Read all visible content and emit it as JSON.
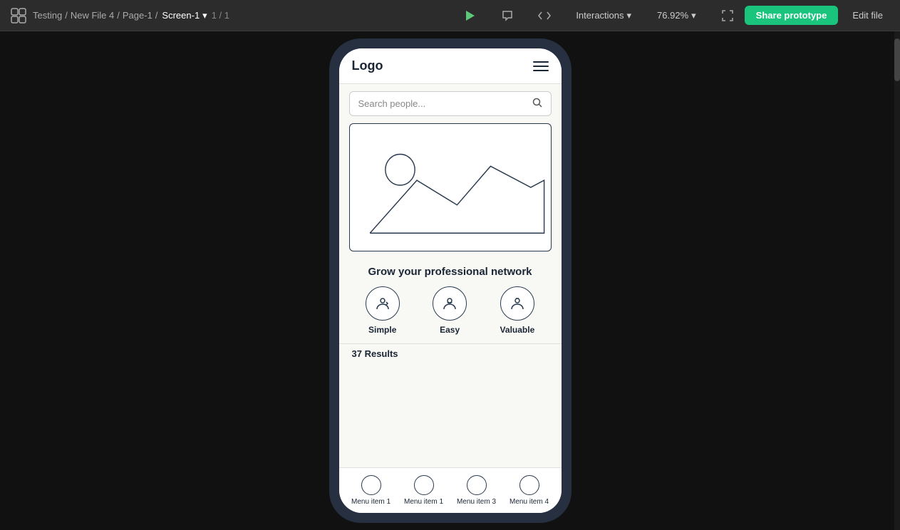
{
  "topbar": {
    "app_logo": "🏠",
    "breadcrumb": {
      "workspace": "Testing",
      "separator1": "/",
      "file": "New File 4",
      "separator2": "/",
      "page": "Page-1",
      "sep3": "/",
      "screen": "Screen-1",
      "chevron": "▾",
      "count": "1 / 1"
    },
    "play_btn": "▶",
    "comment_btn": "💬",
    "code_btn": "</>",
    "interactions_label": "Interactions",
    "interactions_chevron": "▾",
    "zoom_level": "76.92%",
    "zoom_chevron": "▾",
    "fullscreen_icon": "⛶",
    "share_btn": "Share prototype",
    "edit_file_btn": "Edit file"
  },
  "phone": {
    "nav": {
      "logo": "Logo",
      "menu_icon": "hamburger"
    },
    "search": {
      "placeholder": "Search people..."
    },
    "tagline": "Grow your professional network",
    "features": [
      {
        "label": "Simple"
      },
      {
        "label": "Easy"
      },
      {
        "label": "Valuable"
      }
    ],
    "results": "37 Results",
    "tabbar": [
      {
        "label": "Menu item 1"
      },
      {
        "label": "Menu item 1"
      },
      {
        "label": "Menu item 3"
      },
      {
        "label": "Menu item 4"
      }
    ]
  }
}
